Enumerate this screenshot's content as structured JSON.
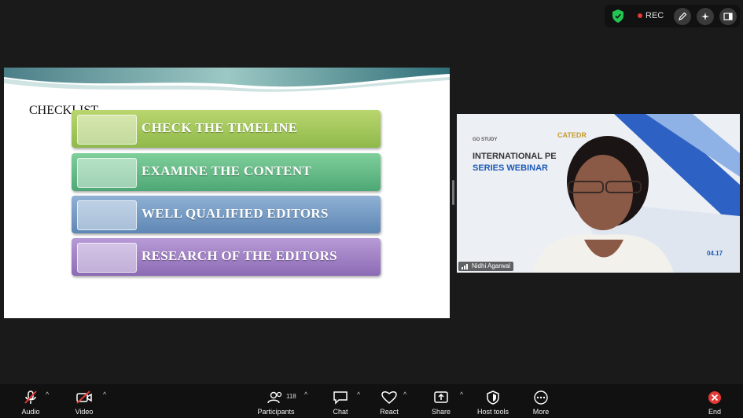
{
  "top": {
    "rec_label": "REC"
  },
  "slide": {
    "title": "CHECKLIST",
    "items": [
      {
        "label": "CHECK THE TIMELINE",
        "color": "#a3c85a"
      },
      {
        "label": "EXAMINE THE CONTENT",
        "color": "#62bc86"
      },
      {
        "label": "WELL QUALIFIED EDITORS",
        "color": "#7199c4"
      },
      {
        "label": "RESEARCH OF THE EDITORS",
        "color": "#a180c6"
      }
    ]
  },
  "video": {
    "logos": [
      "GO STUDY",
      "CATEDR"
    ],
    "webinar_line1": "INTERNATIONAL PE",
    "webinar_line2": "SERIES WEBINAR",
    "date_fragment": "04.17",
    "participant_name": "Nidhi Agarwal"
  },
  "toolbar": {
    "audio": "Audio",
    "video": "Video",
    "participants": "Participants",
    "participants_count": "118",
    "chat": "Chat",
    "react": "React",
    "share": "Share",
    "host_tools": "Host tools",
    "more": "More",
    "end": "End",
    "caret": "^"
  }
}
